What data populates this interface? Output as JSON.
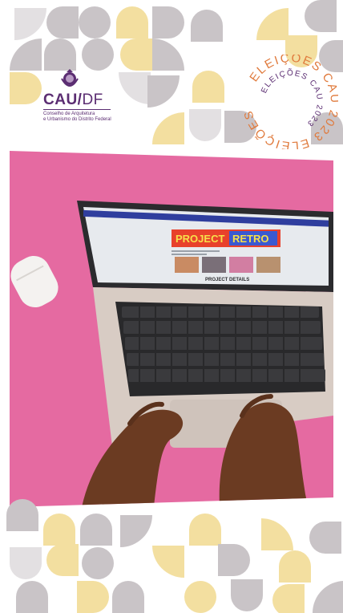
{
  "logo": {
    "name_main": "CAU/",
    "name_suffix": "DF",
    "subtitle_line1": "Conselho de Arquitetura",
    "subtitle_line2": "e Urbanismo do Distrito Federal"
  },
  "badge": {
    "outer_text": "ELEIÇÕES CAU 2023 ELEIÇÕES",
    "inner_text": "ELEIÇÕES CAU 2023"
  },
  "screen": {
    "banner_word1": "PROJECT",
    "banner_word2": "RETRO",
    "details_heading": "PROJECT DETAILS"
  },
  "colors": {
    "purple": "#5b2d72",
    "pink_background": "#e56aa1",
    "pattern_yellow": "#f3dfa0",
    "pattern_grey": "#c9c4c7",
    "badge_orange": "#e07a3c"
  }
}
